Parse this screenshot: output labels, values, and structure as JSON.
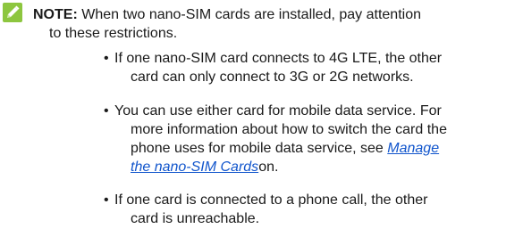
{
  "note": {
    "icon": "pencil-edit-icon",
    "icon_color": "#8dc63f",
    "label": "NOTE:",
    "line1": " When two nano-SIM cards are installed, pay attention",
    "line2": "to these restrictions."
  },
  "bullets": [
    {
      "lines": [
        "If one nano-SIM card connects to 4G LTE, the other",
        "card can only connect to 3G or 2G networks."
      ]
    },
    {
      "lines": [
        "You can use either card for mobile data service. For",
        "more information about how to switch the card the",
        "phone uses for mobile data service, see "
      ],
      "link_line1": "Manage",
      "link_line2": "the nano-SIM Cards",
      "after_link": "on."
    },
    {
      "lines": [
        "If one card is connected to a phone call, the other",
        "card is unreachable."
      ]
    }
  ],
  "bullet_char": "•",
  "link_color": "#1155cc"
}
